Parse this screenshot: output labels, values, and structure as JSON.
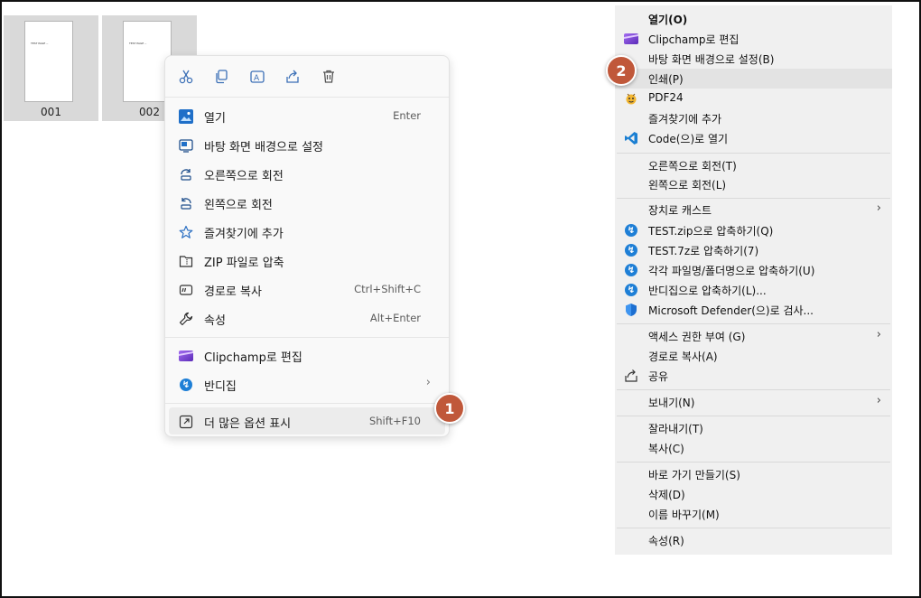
{
  "files": [
    {
      "name": "001",
      "page_text": "TEST PAGE --"
    },
    {
      "name": "002",
      "page_text": "TEST PAGE --"
    }
  ],
  "toolbar_icons": [
    "cut-icon",
    "copy-icon",
    "rename-icon",
    "share-icon",
    "delete-icon"
  ],
  "new_menu": {
    "items": [
      {
        "label": "열기",
        "shortcut": "Enter",
        "icon": "photos-icon"
      },
      {
        "label": "바탕 화면 배경으로 설정",
        "shortcut": "",
        "icon": "wallpaper-icon"
      },
      {
        "label": "오른쪽으로 회전",
        "shortcut": "",
        "icon": "rotate-right-icon"
      },
      {
        "label": "왼쪽으로 회전",
        "shortcut": "",
        "icon": "rotate-left-icon"
      },
      {
        "label": "즐겨찾기에 추가",
        "shortcut": "",
        "icon": "star-icon"
      },
      {
        "label": "ZIP 파일로 압축",
        "shortcut": "",
        "icon": "zip-icon"
      },
      {
        "label": "경로로 복사",
        "shortcut": "Ctrl+Shift+C",
        "icon": "copy-path-icon"
      },
      {
        "label": "속성",
        "shortcut": "Alt+Enter",
        "icon": "wrench-icon"
      },
      {
        "label": "Clipchamp로 편집",
        "shortcut": "",
        "icon": "clipchamp-icon"
      },
      {
        "label": "반디집",
        "shortcut": "",
        "icon": "bandizip-icon"
      },
      {
        "label": "더 많은 옵션 표시",
        "shortcut": "Shift+F10",
        "icon": "more-options-icon"
      }
    ],
    "submenu_arrow": "›"
  },
  "badges": [
    "1",
    "2"
  ],
  "classic_menu": {
    "items": [
      {
        "label": "열기(O)",
        "icon": "",
        "bold": true
      },
      {
        "label": "Clipchamp로 편집",
        "icon": "clipchamp-icon"
      },
      {
        "label": "바탕 화면 배경으로 설정(B)",
        "icon": ""
      },
      {
        "label": "인쇄(P)",
        "icon": ""
      },
      {
        "label": "PDF24",
        "icon": "pdf24-icon"
      },
      {
        "label": "즐겨찾기에 추가",
        "icon": ""
      },
      {
        "label": "Code(으)로 열기",
        "icon": "vscode-icon"
      },
      {
        "label": "오른쪽으로 회전(T)",
        "icon": ""
      },
      {
        "label": "왼쪽으로 회전(L)",
        "icon": ""
      },
      {
        "label": "장치로 캐스트",
        "icon": ""
      },
      {
        "label": "TEST.zip으로 압축하기(Q)",
        "icon": "bandizip-icon"
      },
      {
        "label": "TEST.7z로 압축하기(7)",
        "icon": "bandizip-icon"
      },
      {
        "label": "각각 파일명/폴더명으로 압축하기(U)",
        "icon": "bandizip-icon"
      },
      {
        "label": "반디집으로 압축하기(L)...",
        "icon": "bandizip-icon"
      },
      {
        "label": "Microsoft Defender(으)로 검사...",
        "icon": "defender-icon"
      },
      {
        "label": "액세스 권한 부여 (G)",
        "icon": ""
      },
      {
        "label": "경로로 복사(A)",
        "icon": ""
      },
      {
        "label": "공유",
        "icon": "share-icon"
      },
      {
        "label": "보내기(N)",
        "icon": ""
      },
      {
        "label": "잘라내기(T)",
        "icon": ""
      },
      {
        "label": "복사(C)",
        "icon": ""
      },
      {
        "label": "바로 가기 만들기(S)",
        "icon": ""
      },
      {
        "label": "삭제(D)",
        "icon": ""
      },
      {
        "label": "이름 바꾸기(M)",
        "icon": ""
      },
      {
        "label": "속성(R)",
        "icon": ""
      }
    ],
    "submenu_arrow": "›"
  },
  "colors": {
    "badge": "#c0583a",
    "accent_blue": "#1e7fd6"
  }
}
